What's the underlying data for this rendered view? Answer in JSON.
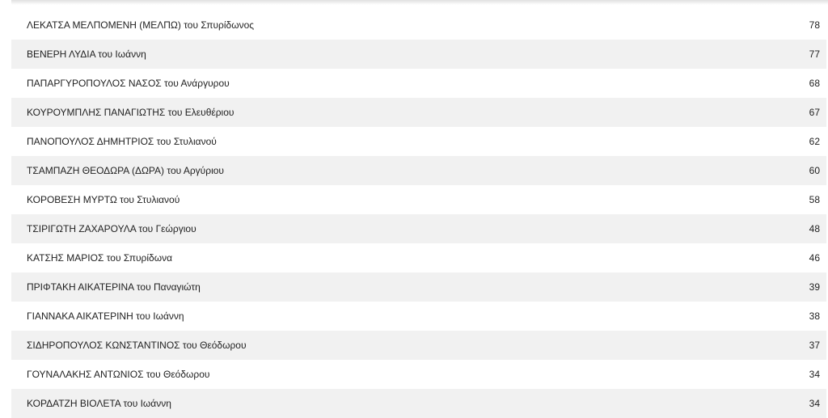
{
  "results": {
    "rows": [
      {
        "name": "ΛΕΚΑΤΣΑ ΜΕΛΠΟΜΕΝΗ (ΜΕΛΠΩ) του Σπυρίδωνος",
        "votes": "78"
      },
      {
        "name": "ΒΕΝΕΡΗ ΛΥΔΙΑ του Ιωάννη",
        "votes": "77"
      },
      {
        "name": "ΠΑΠΑΡΓΥΡΟΠΟΥΛΟΣ ΝΑΣΟΣ του Ανάργυρου",
        "votes": "68"
      },
      {
        "name": "ΚΟΥΡΟΥΜΠΛΗΣ ΠΑΝΑΓΙΩΤΗΣ του Ελευθέριου",
        "votes": "67"
      },
      {
        "name": "ΠΑΝΟΠΟΥΛΟΣ ΔΗΜΗΤΡΙΟΣ του Στυλιανού",
        "votes": "62"
      },
      {
        "name": "ΤΣΑΜΠΑΖΗ ΘΕΟΔΩΡΑ (ΔΩΡΑ) του Αργύριου",
        "votes": "60"
      },
      {
        "name": "ΚΟΡΟΒΕΣΗ ΜΥΡΤΩ του Στυλιανού",
        "votes": "58"
      },
      {
        "name": "ΤΣΙΡΙΓΩΤΗ ΖΑΧΑΡΟΥΛΑ του Γεώργιου",
        "votes": "48"
      },
      {
        "name": "ΚΑΤΣΗΣ ΜΑΡΙΟΣ του Σπυρίδωνα",
        "votes": "46"
      },
      {
        "name": "ΠΡΙΦΤΑΚΗ ΑΙΚΑΤΕΡΙΝΑ του Παναγιώτη",
        "votes": "39"
      },
      {
        "name": "ΓΙΑΝΝΑΚΑ ΑΙΚΑΤΕΡΙΝΗ του Ιωάννη",
        "votes": "38"
      },
      {
        "name": "ΣΙΔΗΡΟΠΟΥΛΟΣ ΚΩΝΣΤΑΝΤΙΝΟΣ του Θεόδωρου",
        "votes": "37"
      },
      {
        "name": "ΓΟΥΝΑΛΑΚΗΣ ΑΝΤΩΝΙΟΣ του Θεόδωρου",
        "votes": "34"
      },
      {
        "name": "ΚΟΡΔΑΤΖΗ ΒΙΟΛΕΤΑ του Ιωάννη",
        "votes": "34"
      }
    ]
  }
}
